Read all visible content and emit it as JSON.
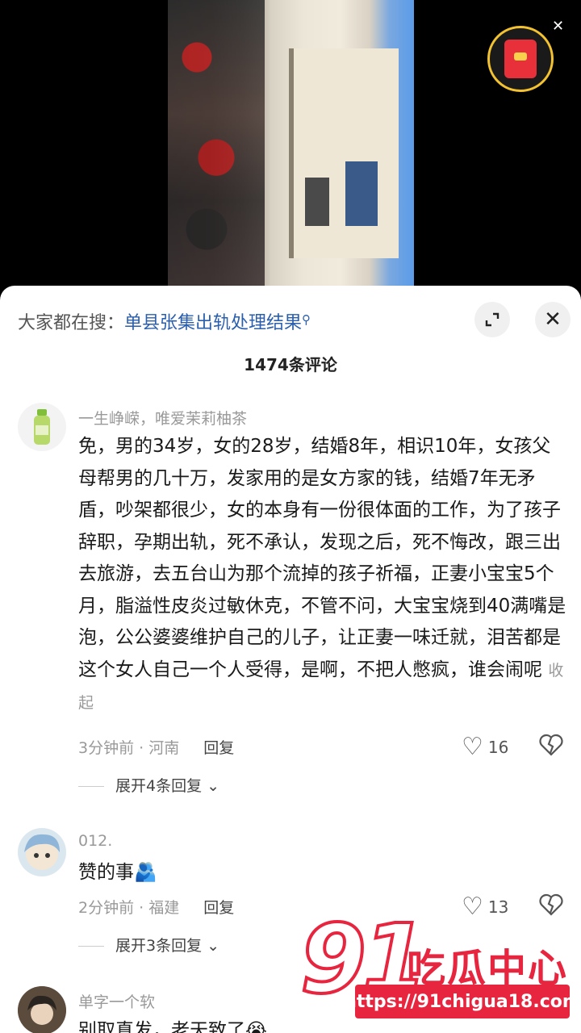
{
  "search": {
    "prefix": "大家都在搜：",
    "term": "单县张集出轨处理结果",
    "icon": "search-icon"
  },
  "comments_count": "1474条评论",
  "comments": [
    {
      "username": "一生峥嵘，唯爱茉莉柚茶",
      "text": "免，男的34岁，女的28岁，结婚8年，相识10年，女孩父母帮男的几十万，发家用的是女方家的钱，结婚7年无矛盾，吵架都很少，女的本身有一份很体面的工作，为了孩子辞职，孕期出轨，死不承认，发现之后，死不悔改，跟三出去旅游，去五台山为那个流掉的孩子祈福，正妻小宝宝5个月，脂溢性皮炎过敏休克，不管不问，大宝宝烧到40满嘴是泡，公公婆婆维护自己的儿子，让正妻一味迁就，泪苦都是这个女人自己一个人受得，是啊，不把人憋疯，谁会闹呢",
      "collapse": "收起",
      "meta": "3分钟前 · 河南",
      "reply": "回复",
      "likes": "16",
      "expand": "展开4条回复"
    },
    {
      "username": "012.",
      "text": "赞的事🫂",
      "meta": "2分钟前 · 福建",
      "reply": "回复",
      "likes": "13",
      "expand": "展开3条回复"
    },
    {
      "username": "单字一个软",
      "text": "别取真发，老天致了😭"
    }
  ],
  "watermark": {
    "number": "91",
    "title": "吃瓜中心",
    "url": "https://91chigua18.com"
  },
  "colors": {
    "link": "#2b5fad",
    "brand": "#e8253f"
  }
}
